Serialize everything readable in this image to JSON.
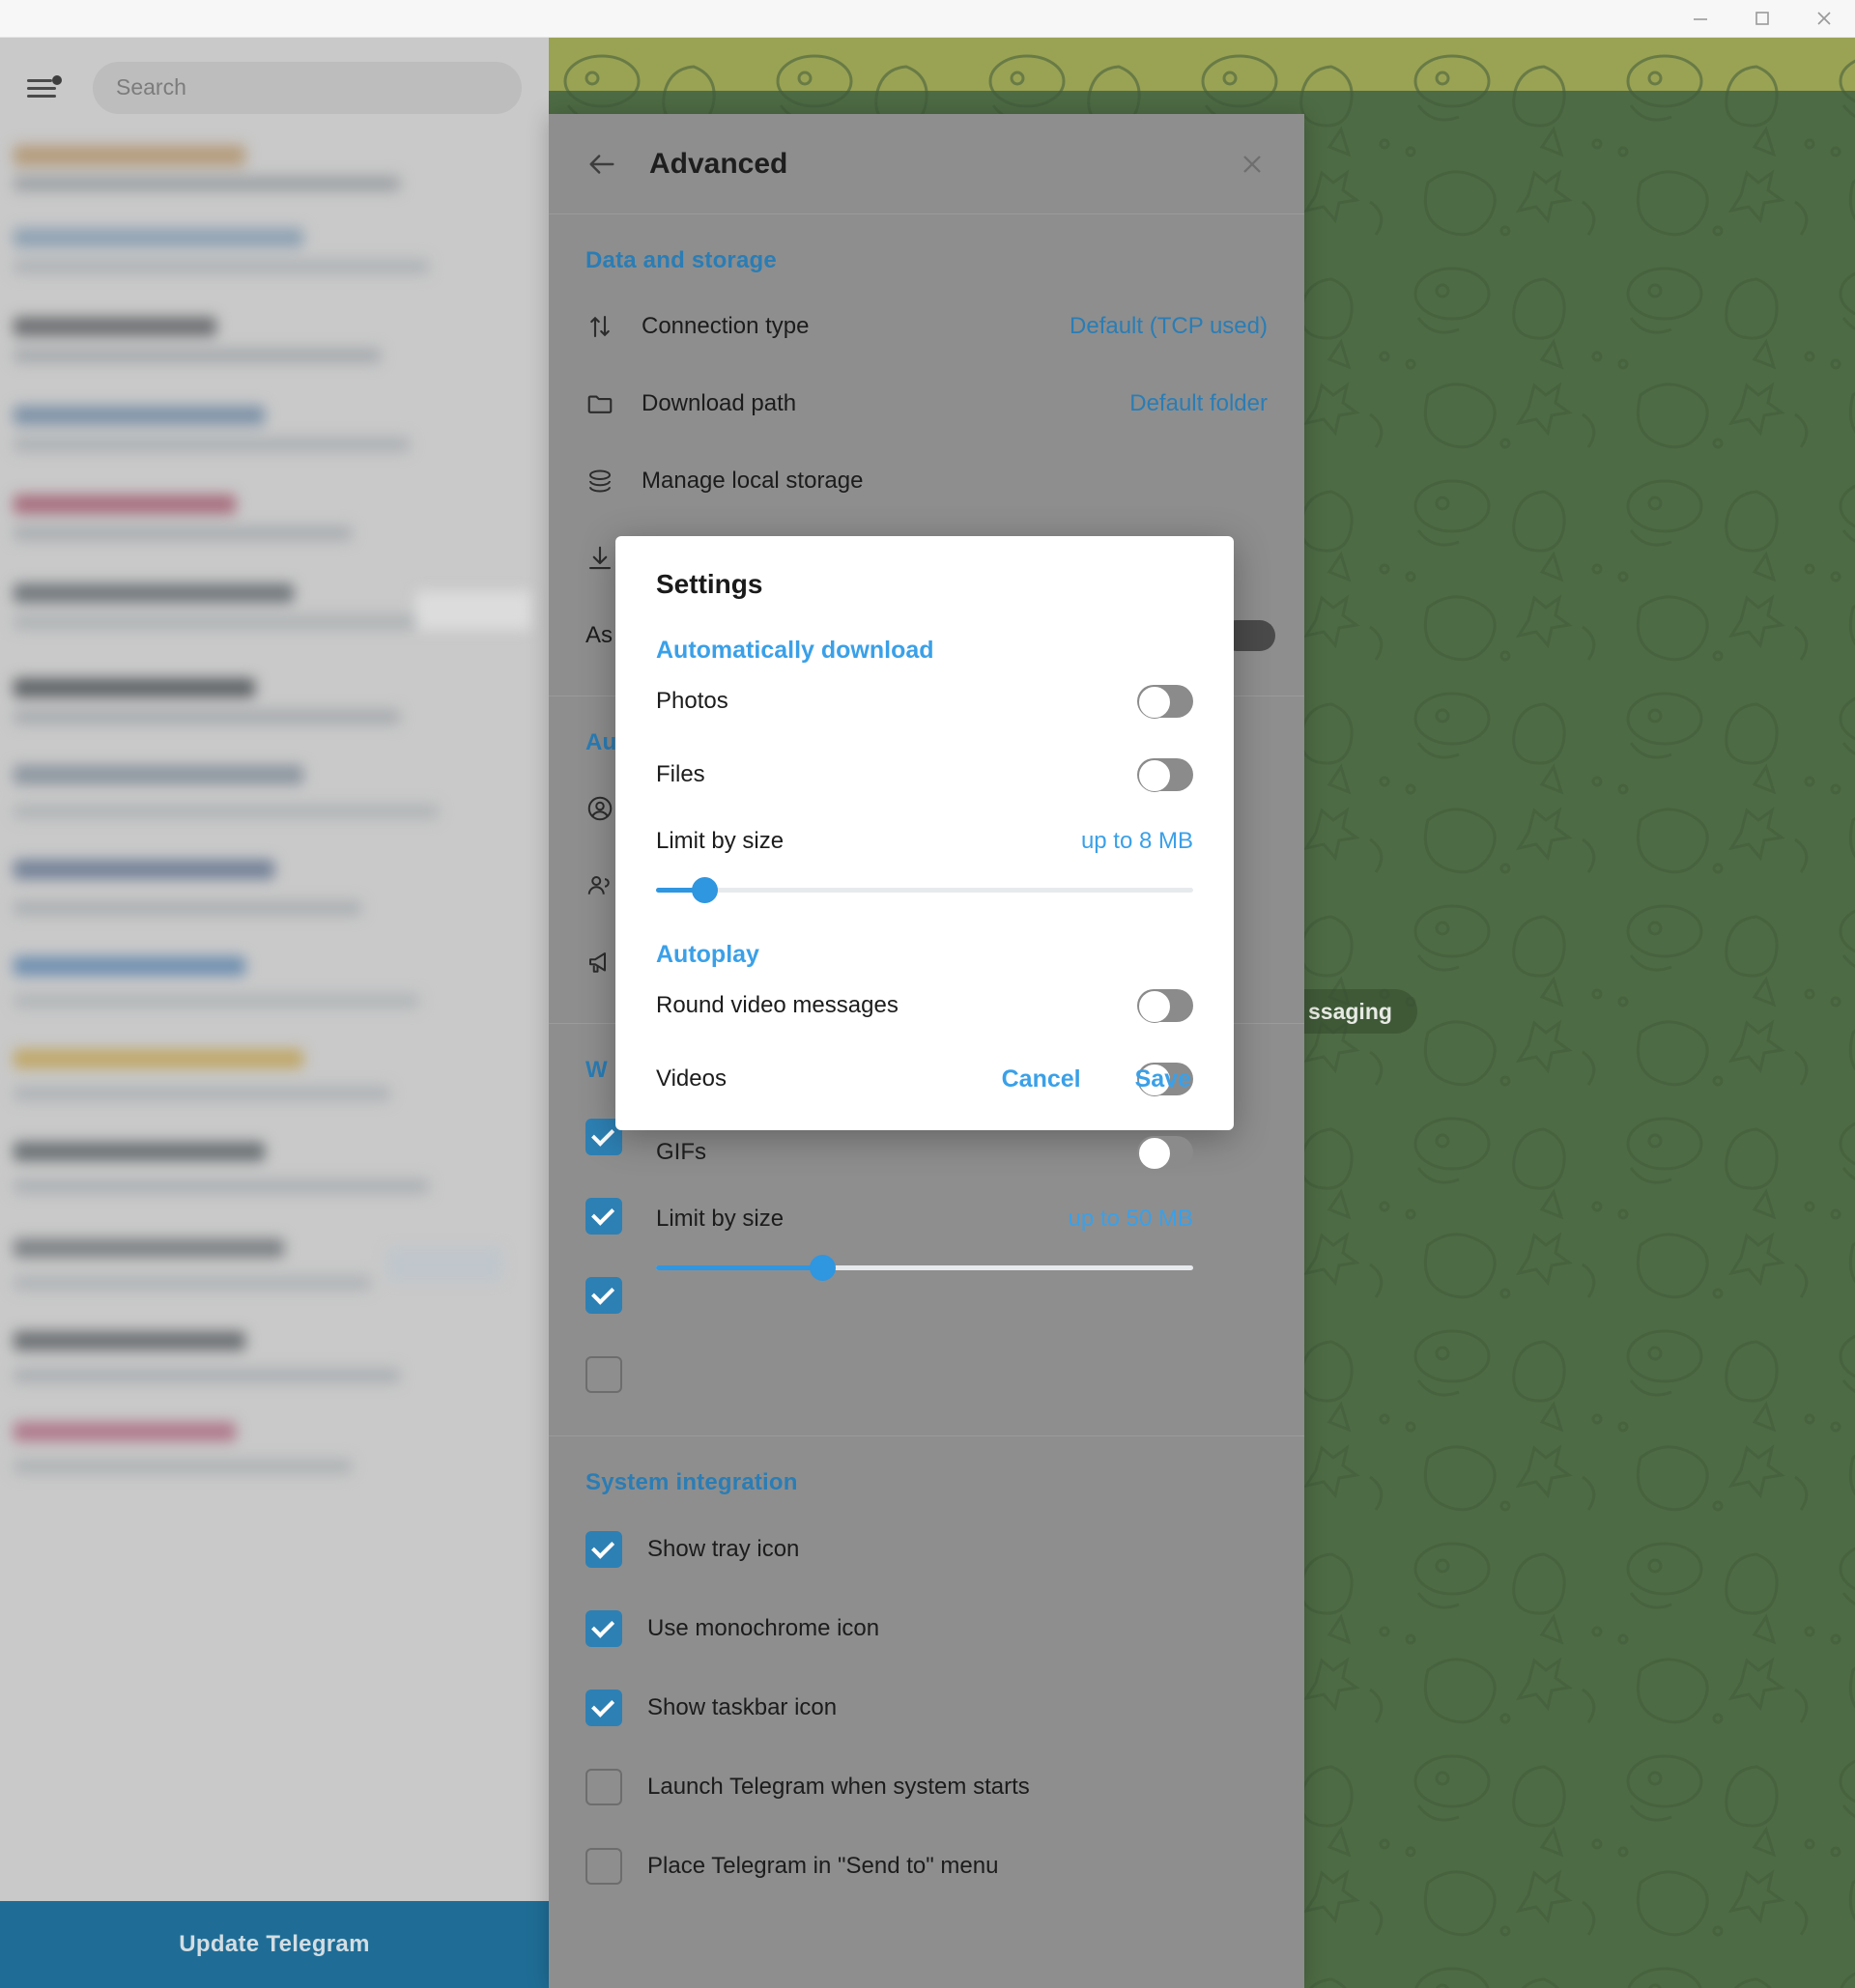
{
  "window": {
    "minimize_label": "Minimize",
    "maximize_label": "Maximize",
    "close_label": "Close"
  },
  "sidebar": {
    "menu_icon": "hamburger-menu-icon",
    "has_badge": true,
    "search_placeholder": "Search",
    "update_button_label": "Update Telegram"
  },
  "chat": {
    "pill_text": "ssaging"
  },
  "panel": {
    "title": "Advanced",
    "back_icon": "arrow-left-icon",
    "close_icon": "close-icon",
    "sections": [
      {
        "title": "Data and storage",
        "rows": [
          {
            "icon": "connection-arrows-icon",
            "label": "Connection type",
            "value": "Default (TCP used)"
          },
          {
            "icon": "folder-icon",
            "label": "Download path",
            "value": "Default folder"
          },
          {
            "icon": "storage-stack-icon",
            "label": "Manage local storage",
            "value": ""
          },
          {
            "icon": "download-icon",
            "label": "",
            "value": ""
          },
          {
            "icon": "",
            "label": "As",
            "value": ""
          }
        ]
      },
      {
        "title": "Au",
        "rows": [
          {
            "icon": "account-circle-icon",
            "label": "",
            "value": ""
          },
          {
            "icon": "contacts-icon",
            "label": "",
            "value": ""
          },
          {
            "icon": "megaphone-icon",
            "label": "",
            "value": ""
          }
        ]
      },
      {
        "title": "W",
        "checkboxes": [
          {
            "label": "",
            "checked": true
          },
          {
            "label": "",
            "checked": true
          },
          {
            "label": "",
            "checked": true
          },
          {
            "label": "",
            "checked": false
          }
        ]
      },
      {
        "title": "System integration",
        "checkboxes": [
          {
            "label": "Show tray icon",
            "checked": true
          },
          {
            "label": "Use monochrome icon",
            "checked": true
          },
          {
            "label": "Show taskbar icon",
            "checked": true
          },
          {
            "label": "Launch Telegram when system starts",
            "checked": false
          },
          {
            "label": "Place Telegram in \"Send to\" menu",
            "checked": false
          }
        ]
      }
    ]
  },
  "modal": {
    "title": "Settings",
    "sections": [
      {
        "heading": "Automatically download",
        "toggles": [
          {
            "label": "Photos",
            "on": false
          },
          {
            "label": "Files",
            "on": false
          }
        ],
        "limit": {
          "label": "Limit by size",
          "value": "up to 8 MB",
          "percent": 9
        }
      },
      {
        "heading": "Autoplay",
        "toggles": [
          {
            "label": "Round video messages",
            "on": false
          },
          {
            "label": "Videos",
            "on": false
          },
          {
            "label": "GIFs",
            "on": false
          }
        ],
        "limit": {
          "label": "Limit by size",
          "value": "up to 50 MB",
          "percent": 31
        }
      }
    ],
    "cancel_label": "Cancel",
    "save_label": "Save"
  },
  "colors": {
    "accent": "#3aa0e8",
    "panel_link": "#2a7db5",
    "checkbox_on": "#2d80b4",
    "update_button": "#1f6d96",
    "wallpaper": "#4d6b44"
  }
}
